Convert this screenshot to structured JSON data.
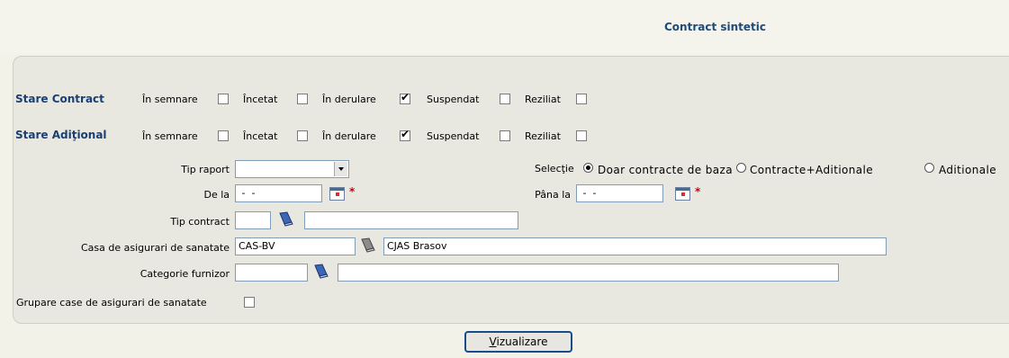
{
  "page_title": "Contract sintetic",
  "stare_contract": {
    "label": "Stare Contract",
    "options": [
      {
        "label": "În semnare",
        "checked": false
      },
      {
        "label": "Încetat",
        "checked": false
      },
      {
        "label": "În derulare",
        "checked": true
      },
      {
        "label": "Suspendat",
        "checked": false
      },
      {
        "label": "Reziliat",
        "checked": false
      }
    ]
  },
  "stare_aditional": {
    "label": "Stare Adiţional",
    "options": [
      {
        "label": "În semnare",
        "checked": false
      },
      {
        "label": "Încetat",
        "checked": false
      },
      {
        "label": "În derulare",
        "checked": true
      },
      {
        "label": "Suspendat",
        "checked": false
      },
      {
        "label": "Reziliat",
        "checked": false
      }
    ]
  },
  "tip_raport": {
    "label": "Tip raport",
    "value": ""
  },
  "selectie": {
    "label": "Selecţie",
    "options": [
      {
        "label": "Doar contracte de baza",
        "selected": true
      },
      {
        "label": "Contracte+Aditionale",
        "selected": false
      },
      {
        "label": "Aditionale",
        "selected": false
      }
    ]
  },
  "de_la": {
    "label": "De la",
    "value": " -  - "
  },
  "pana_la": {
    "label": "Pâna la",
    "value": " -  - "
  },
  "tip_contract": {
    "label": "Tip contract",
    "code": "",
    "name": ""
  },
  "casa": {
    "label": "Casa de asigurari de sanatate",
    "code": "CAS-BV",
    "name": "CJAS Brasov"
  },
  "categorie": {
    "label": "Categorie furnizor",
    "code": "",
    "name": ""
  },
  "grupare": {
    "label": "Grupare case de asigurari de sanatate",
    "checked": false
  },
  "required_mark": "*",
  "button": {
    "label": "Vizualizare",
    "accel": "V",
    "rest": "izualizare"
  },
  "colors": {
    "accent": "#1a3f73",
    "button_border": "#1a4c8b",
    "required": "#d0000a"
  }
}
